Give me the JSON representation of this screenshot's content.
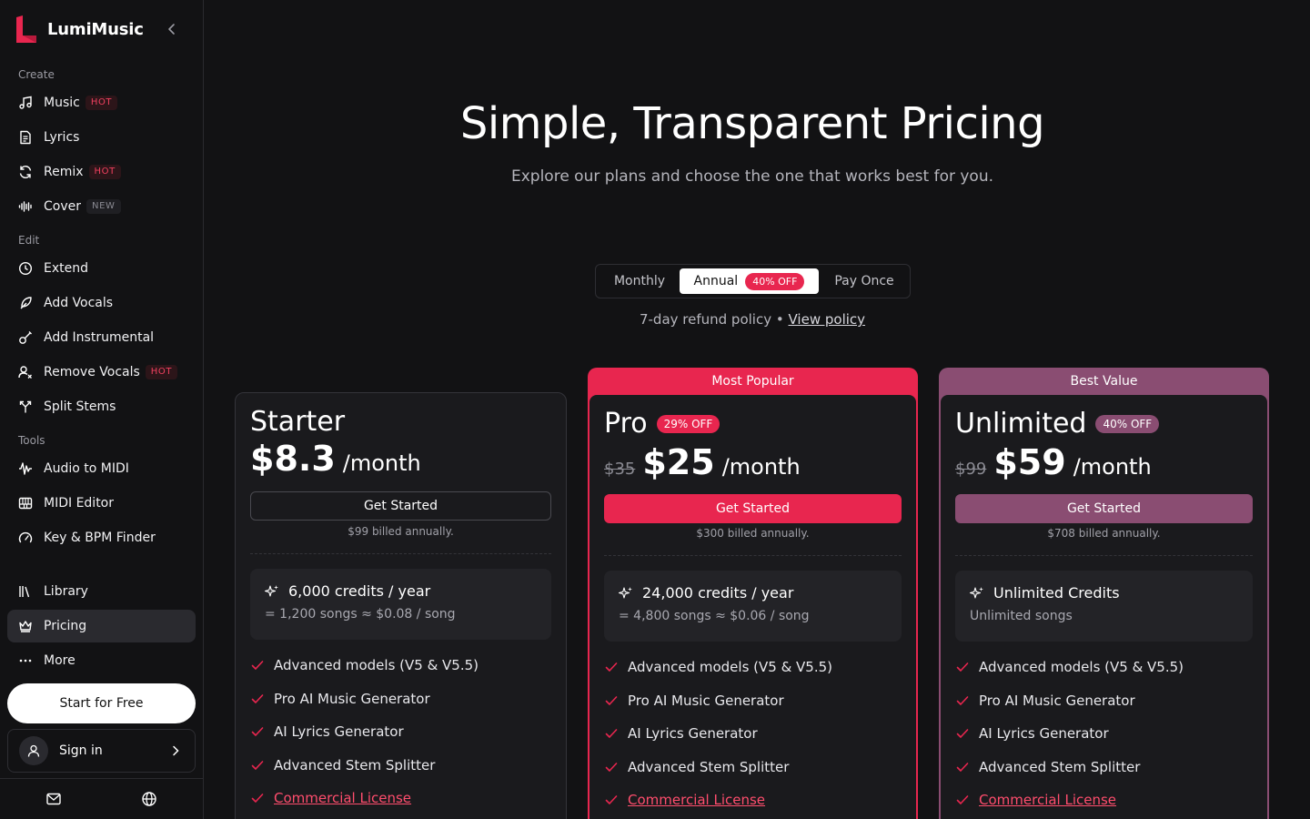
{
  "app": {
    "name": "LumiMusic"
  },
  "colors": {
    "accent_pink": "#e8264f",
    "accent_mauve": "#8a4d72",
    "bg": "#121214"
  },
  "sidebar": {
    "sections": [
      {
        "label": "Create",
        "items": [
          {
            "label": "Music",
            "icon": "music-note-icon",
            "tag": "HOT"
          },
          {
            "label": "Lyrics",
            "icon": "document-icon"
          },
          {
            "label": "Remix",
            "icon": "refresh-icon",
            "tag": "HOT"
          },
          {
            "label": "Cover",
            "icon": "waveform-icon",
            "tag": "NEW"
          }
        ]
      },
      {
        "label": "Edit",
        "items": [
          {
            "label": "Extend",
            "icon": "clock-icon"
          },
          {
            "label": "Add Vocals",
            "icon": "feather-icon"
          },
          {
            "label": "Add Instrumental",
            "icon": "guitar-icon"
          },
          {
            "label": "Remove Vocals",
            "icon": "user-x-icon",
            "tag": "HOT"
          },
          {
            "label": "Split Stems",
            "icon": "split-icon"
          }
        ]
      },
      {
        "label": "Tools",
        "items": [
          {
            "label": "Audio to MIDI",
            "icon": "audio-wave-icon"
          },
          {
            "label": "MIDI Editor",
            "icon": "piano-icon"
          },
          {
            "label": "Key & BPM Finder",
            "icon": "gauge-icon"
          }
        ]
      }
    ],
    "bottom_items": [
      {
        "label": "Library",
        "icon": "library-icon"
      },
      {
        "label": "Pricing",
        "icon": "crown-icon",
        "active": true
      },
      {
        "label": "More",
        "icon": "ellipsis-icon"
      }
    ],
    "start_free": "Start for Free",
    "sign_in": "Sign in"
  },
  "hero": {
    "title": "Simple, Transparent Pricing",
    "subtitle": "Explore our plans and choose the one that works best for you."
  },
  "billing_toggle": {
    "options": [
      "Monthly",
      "Annual",
      "Pay Once"
    ],
    "selected": "Annual",
    "annual_badge": "40% OFF"
  },
  "refund": {
    "text": "7-day refund policy •",
    "link": "View policy"
  },
  "plans": [
    {
      "name": "Starter",
      "price": "$8.3",
      "per": "/month",
      "cta": "Get Started",
      "billed": "$99 billed annually.",
      "credits_title": "6,000 credits / year",
      "credits_sub": "= 1,200 songs ≈ $0.08 / song",
      "features": [
        "Advanced models (V5 & V5.5)",
        "Pro AI Music Generator",
        "AI Lyrics Generator",
        "Advanced Stem Splitter",
        "Commercial License"
      ]
    },
    {
      "name": "Pro",
      "ribbon": "Most Popular",
      "badge": "29% OFF",
      "old_price": "$35",
      "price": "$25",
      "per": "/month",
      "cta": "Get Started",
      "billed": "$300 billed annually.",
      "credits_title": "24,000 credits / year",
      "credits_sub": "= 4,800 songs ≈ $0.06 / song",
      "features": [
        "Advanced models (V5 & V5.5)",
        "Pro AI Music Generator",
        "AI Lyrics Generator",
        "Advanced Stem Splitter",
        "Commercial License"
      ]
    },
    {
      "name": "Unlimited",
      "ribbon": "Best Value",
      "badge": "40% OFF",
      "old_price": "$99",
      "price": "$59",
      "per": "/month",
      "cta": "Get Started",
      "billed": "$708 billed annually.",
      "credits_title": "Unlimited Credits",
      "credits_sub": "Unlimited songs",
      "features": [
        "Advanced models (V5 & V5.5)",
        "Pro AI Music Generator",
        "AI Lyrics Generator",
        "Advanced Stem Splitter",
        "Commercial License"
      ]
    }
  ]
}
